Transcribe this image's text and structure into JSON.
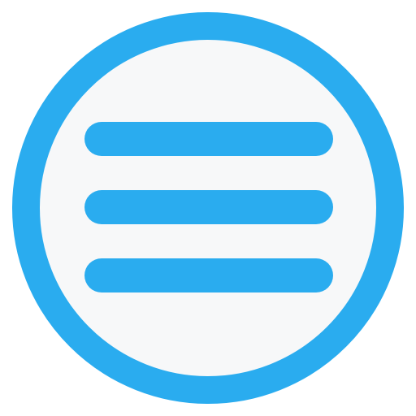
{
  "menu_icon": {
    "icon": "hamburger-menu-icon",
    "color": "#2AACEF",
    "background": "#F7F8F9"
  }
}
